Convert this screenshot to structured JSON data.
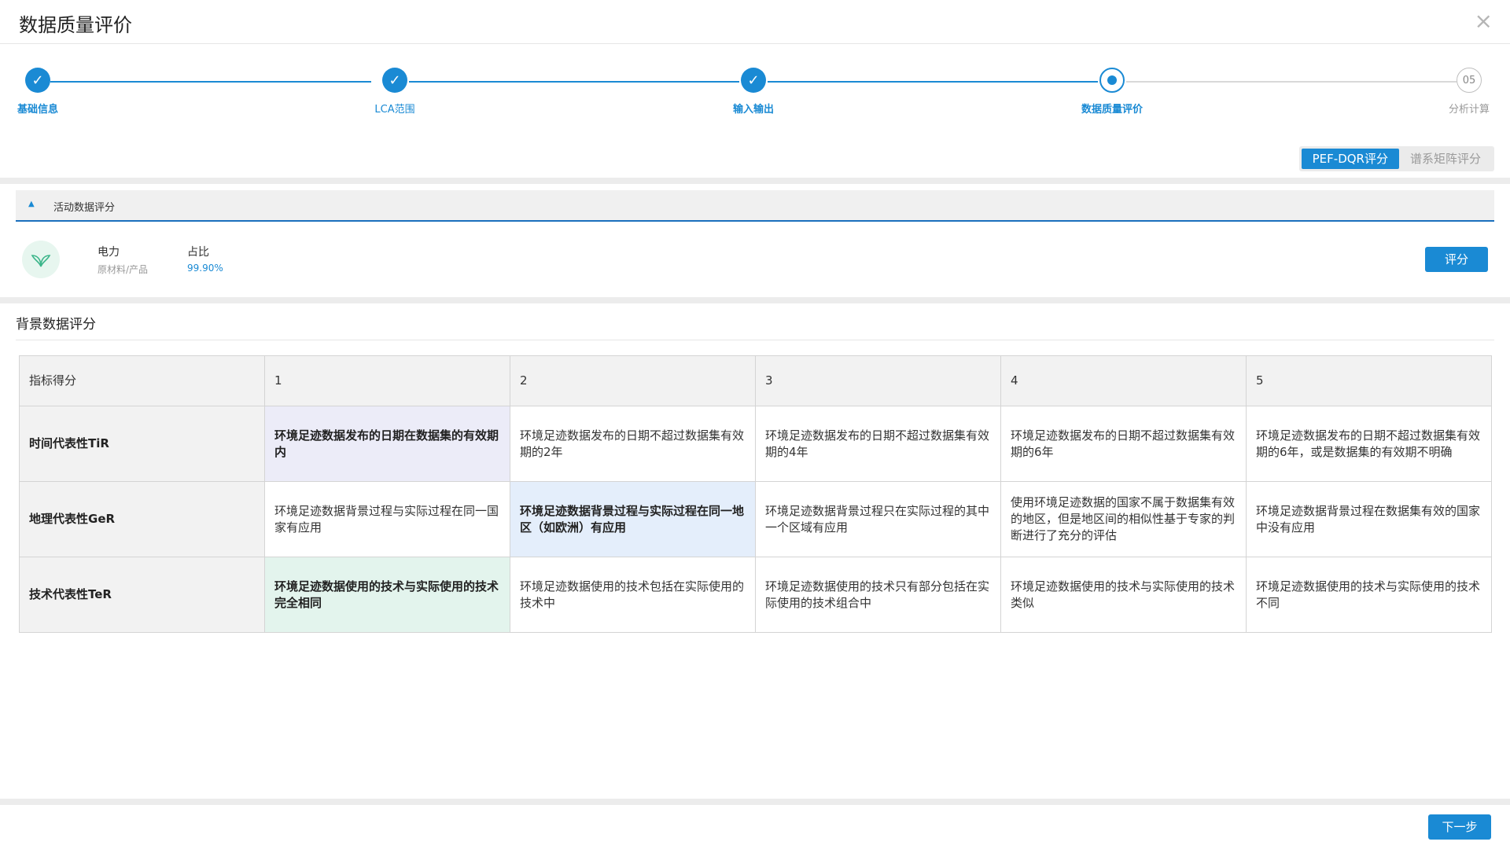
{
  "header": {
    "title": "数据质量评价",
    "close": "×"
  },
  "stepper": {
    "steps": [
      {
        "label": "基础信息",
        "status": "done",
        "mark": "✓"
      },
      {
        "label": "LCA范围",
        "status": "done",
        "mark": "✓"
      },
      {
        "label": "输入输出",
        "status": "done",
        "mark": "✓"
      },
      {
        "label": "数据质量评价",
        "status": "active",
        "mark": ""
      },
      {
        "label": "分析计算",
        "status": "pending",
        "mark": "05"
      }
    ]
  },
  "method_toggle": {
    "options": [
      "PEF-DQR评分",
      "谱系矩阵评分"
    ],
    "selected": "PEF-DQR评分"
  },
  "activity": {
    "section_title": "活动数据评分",
    "arrow": "▲",
    "item": {
      "name": "电力",
      "category": "原材料/产品",
      "share_label": "占比",
      "share_value": "99.90%"
    },
    "score_button": "评分"
  },
  "background": {
    "section_title": "背景数据评分",
    "table": {
      "header": [
        "指标得分",
        "1",
        "2",
        "3",
        "4",
        "5"
      ],
      "rows": [
        {
          "label": "时间代表性TiR",
          "selected": 1,
          "cells": [
            "环境足迹数据发布的日期在数据集的有效期内",
            "环境足迹数据发布的日期不超过数据集有效期的2年",
            "环境足迹数据发布的日期不超过数据集有效期的4年",
            "环境足迹数据发布的日期不超过数据集有效期的6年",
            "环境足迹数据发布的日期不超过数据集有效期的6年，或是数据集的有效期不明确"
          ]
        },
        {
          "label": "地理代表性GeR",
          "selected": 2,
          "cells": [
            "环境足迹数据背景过程与实际过程在同一国家有应用",
            "环境足迹数据背景过程与实际过程在同一地区（如欧洲）有应用",
            "环境足迹数据背景过程只在实际过程的其中一个区域有应用",
            "使用环境足迹数据的国家不属于数据集有效的地区，但是地区间的相似性基于专家的判断进行了充分的评估",
            "环境足迹数据背景过程在数据集有效的国家中没有应用"
          ]
        },
        {
          "label": "技术代表性TeR",
          "selected": 1,
          "cells": [
            "环境足迹数据使用的技术与实际使用的技术完全相同",
            "环境足迹数据使用的技术包括在实际使用的技术中",
            "环境足迹数据使用的技术只有部分包括在实际使用的技术组合中",
            "环境足迹数据使用的技术与实际使用的技术类似",
            "环境足迹数据使用的技术与实际使用的技术不同"
          ]
        }
      ]
    }
  },
  "footer": {
    "next_button": "下一步"
  },
  "colors": {
    "accent": "#1a8ad4",
    "row1_selected": "#ececf8",
    "row2_selected": "#e4eefb",
    "row3_selected": "#e3f4ed"
  }
}
